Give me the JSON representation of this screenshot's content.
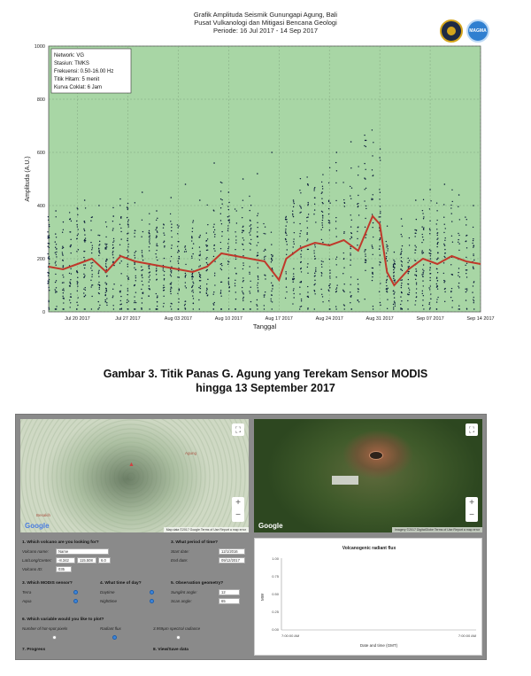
{
  "seismic_chart": {
    "title_lines": [
      "Grafik Amplituda Seismik Gunungapi Agung, Bali",
      "Pusat Vulkanologi dan Mitigasi Bencana Geologi",
      "Periode: 16 Jul 2017 - 14 Sep 2017"
    ],
    "logo_right_text": "MAGMA",
    "info_box": [
      "Network: VG",
      "Stasiun: TMKS",
      "Frekuensi: 0.50-16.00 Hz",
      "Titik Hitam: 5 menit",
      "Kurva Coklat: 6 Jam"
    ],
    "colors": {
      "background": "#a8d6a5",
      "dots": "#0a1a3a",
      "curve": "#c0392b"
    }
  },
  "chart_data": {
    "type": "scatter",
    "xlabel": "Tanggal",
    "ylabel": "Amplituda (A.U.)",
    "ylim": [
      0,
      1000
    ],
    "yticks": [
      0,
      200,
      400,
      600,
      800,
      1000
    ],
    "xlim": [
      "2017-07-16",
      "2017-09-14"
    ],
    "xtick_labels": [
      "Jul 20 2017",
      "Jul 27 2017",
      "Aug 03 2017",
      "Aug 10 2017",
      "Aug 17 2017",
      "Aug 24 2017",
      "Aug 31 2017",
      "Sep 07 2017",
      "Sep 14 2017"
    ],
    "xtick_dates": [
      "2017-07-20",
      "2017-07-27",
      "2017-08-03",
      "2017-08-10",
      "2017-08-17",
      "2017-08-24",
      "2017-08-31",
      "2017-09-07",
      "2017-09-14"
    ],
    "grid": true,
    "legend_placement": "top-left",
    "series": [
      {
        "x": [
          "2017-07-16",
          "2017-07-18",
          "2017-07-20",
          "2017-07-22",
          "2017-07-24",
          "2017-07-26",
          "2017-07-28",
          "2017-07-30",
          "2017-08-01",
          "2017-08-03",
          "2017-08-05",
          "2017-08-07",
          "2017-08-09",
          "2017-08-11",
          "2017-08-13",
          "2017-08-15",
          "2017-08-17",
          "2017-08-18",
          "2017-08-20",
          "2017-08-22",
          "2017-08-24",
          "2017-08-26",
          "2017-08-28",
          "2017-08-30",
          "2017-08-31",
          "2017-09-01",
          "2017-09-02",
          "2017-09-04",
          "2017-09-06",
          "2017-09-08",
          "2017-09-10",
          "2017-09-12",
          "2017-09-14"
        ],
        "y": [
          170,
          160,
          180,
          200,
          150,
          210,
          190,
          180,
          170,
          160,
          150,
          170,
          220,
          210,
          200,
          190,
          120,
          200,
          240,
          260,
          250,
          270,
          230,
          360,
          330,
          150,
          100,
          160,
          200,
          180,
          210,
          190,
          180
        ]
      },
      {
        "x": [
          "2017-07-17",
          "2017-07-19",
          "2017-07-21",
          "2017-07-23",
          "2017-07-25",
          "2017-07-27",
          "2017-07-29",
          "2017-07-31",
          "2017-08-02",
          "2017-08-04",
          "2017-08-06",
          "2017-08-08",
          "2017-08-10",
          "2017-08-12",
          "2017-08-14",
          "2017-08-16",
          "2017-08-19",
          "2017-08-21",
          "2017-08-23",
          "2017-08-25",
          "2017-08-27",
          "2017-08-29",
          "2017-08-31",
          "2017-09-03",
          "2017-09-05",
          "2017-09-07",
          "2017-09-09",
          "2017-09-11",
          "2017-09-13"
        ],
        "y": [
          380,
          350,
          420,
          400,
          360,
          390,
          450,
          380,
          430,
          480,
          420,
          560,
          450,
          500,
          520,
          600,
          420,
          480,
          450,
          600,
          640,
          500,
          580,
          350,
          420,
          460,
          480,
          440,
          400
        ]
      }
    ]
  },
  "figure_caption": {
    "line1": "Gambar 3. Titik Panas G. Agung yang Terekam Sensor MODIS",
    "line2": "hingga 13 September 2017"
  },
  "map_terrain": {
    "google": "Google",
    "attribution": "Map data ©2017 Google  Terms of Use  Report a map error",
    "place_label": "Agung",
    "town_label": "Besakih"
  },
  "map_satellite": {
    "google": "Google",
    "attribution": "Imagery ©2017 DigitalGlobe  Terms of Use  Report a map error"
  },
  "form": {
    "q1": "1. Which volcano are you looking for?",
    "volcano_name_label": "Volcano name:",
    "volcano_name_value": "Name",
    "latlon_label": "Lat/Long/Center:",
    "lat_value": "-8.342",
    "lon_value": "115.508",
    "center_value": "6.0",
    "volcano_id_label": "Volcano ID:",
    "volcano_id_value": "035",
    "q3": "3. What period of time?",
    "start_date_label": "Start date:",
    "start_date_value": "12/1/2016",
    "end_date_label": "End date:",
    "end_date_value": "09/12/2017",
    "q_sensor": "3. Which MODIS sensor?",
    "terra_label": "Terra",
    "aqua_label": "Aqua",
    "q_time": "4. What time of day?",
    "daytime_label": "Daytime",
    "nighttime_label": "Nighttime",
    "q_geom": "5. Observation geometry?",
    "sunglint_label": "Sunglint angle:",
    "sunglint_value": "12",
    "scan_label": "Scan angle:",
    "scan_value": "65",
    "q_var": "6. Which variable would you like to plot?",
    "var1": "Number of hot-spot pixels",
    "var2": "Radiant flux",
    "var3": "3.959µm spectral radiance",
    "progress": "7. Progress",
    "view_save": "8. View/Save data"
  },
  "flux_chart": {
    "title": "Volcanogenic radiant flux",
    "ylabel": "MW",
    "xlabel": "Date and time (GMT)",
    "yticks": [
      "1.00",
      "0.75",
      "0.50",
      "0.25",
      "0.00"
    ],
    "xticks": [
      "7:00:00 AM",
      "7:00:00 AM"
    ]
  }
}
